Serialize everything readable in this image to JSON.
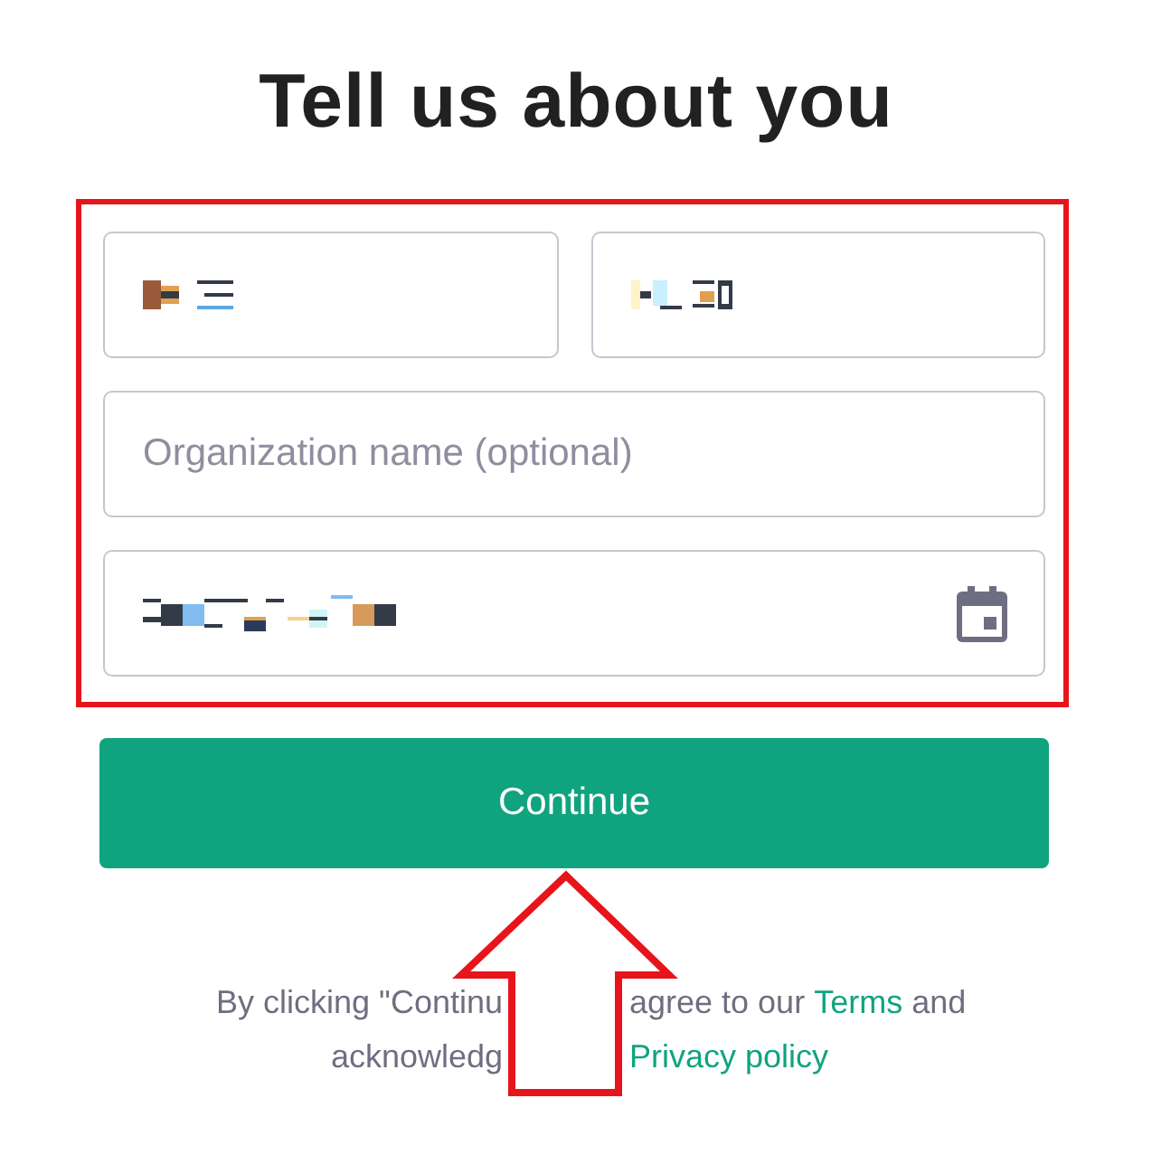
{
  "title": "Tell us about you",
  "highlight_frame": true,
  "fields": [
    {
      "kind": "redacted"
    },
    {
      "kind": "redacted"
    },
    {
      "kind": "text",
      "placeholder": "Organization name (optional)"
    },
    {
      "kind": "date"
    }
  ],
  "button": "Continue",
  "footer": {
    "lines": [
      [
        {
          "kind": "text",
          "text": "By clicking \"Continu"
        },
        {
          "kind": "gap"
        },
        {
          "kind": "text",
          "text": "agree to our"
        },
        {
          "kind": "link",
          "text": "Terms"
        },
        {
          "kind": "text",
          "text": "and"
        }
      ],
      [
        {
          "kind": "text",
          "text": "acknowledg"
        },
        {
          "kind": "gap"
        },
        {
          "kind": "link",
          "text": "Privacy policy"
        }
      ]
    ]
  },
  "arrow_annotation": true
}
